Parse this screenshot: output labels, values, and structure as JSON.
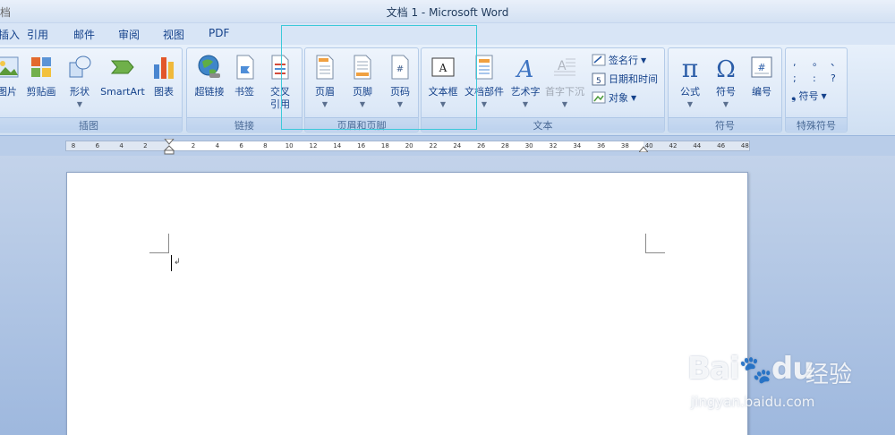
{
  "window": {
    "title": "文档 1 - Microsoft Word",
    "left_cut": "档"
  },
  "tabs": [
    "引用",
    "邮件",
    "审阅",
    "视图",
    "PDF"
  ],
  "groups": {
    "illustrations": {
      "label": "插图",
      "buttons": [
        "图片",
        "剪贴画",
        "形状",
        "SmartArt",
        "图表"
      ]
    },
    "links": {
      "label": "链接",
      "buttons": [
        "超链接",
        "书签",
        "交叉\n引用"
      ]
    },
    "header_footer": {
      "label": "页眉和页脚",
      "buttons": [
        "页眉",
        "页脚",
        "页码"
      ]
    },
    "text": {
      "label": "文本",
      "buttons": [
        "文本框",
        "文档部件",
        "艺术字",
        "首字下沉"
      ],
      "small": [
        "签名行",
        "日期和时间",
        "对象"
      ]
    },
    "symbols": {
      "label": "符号",
      "buttons": [
        "公式",
        "符号",
        "编号"
      ]
    },
    "special": {
      "label": "特殊符号",
      "marks": [
        ",",
        "。",
        "、",
        ";",
        ":",
        "?"
      ],
      "button": "符号"
    }
  },
  "ruler": {
    "numbers": [
      "8",
      "6",
      "4",
      "2",
      "2",
      "4",
      "6",
      "8",
      "10",
      "12",
      "14",
      "16",
      "18",
      "20",
      "22",
      "24",
      "26",
      "28",
      "30",
      "32",
      "34",
      "36",
      "38",
      "40",
      "42",
      "44",
      "46",
      "48"
    ]
  },
  "watermark": {
    "brand": "Bai",
    "brand2": "du",
    "cn": "经验",
    "url": "jingyan.baidu.com"
  },
  "colors": {
    "accent": "#15428b",
    "highlight": "#3cc9d9"
  }
}
